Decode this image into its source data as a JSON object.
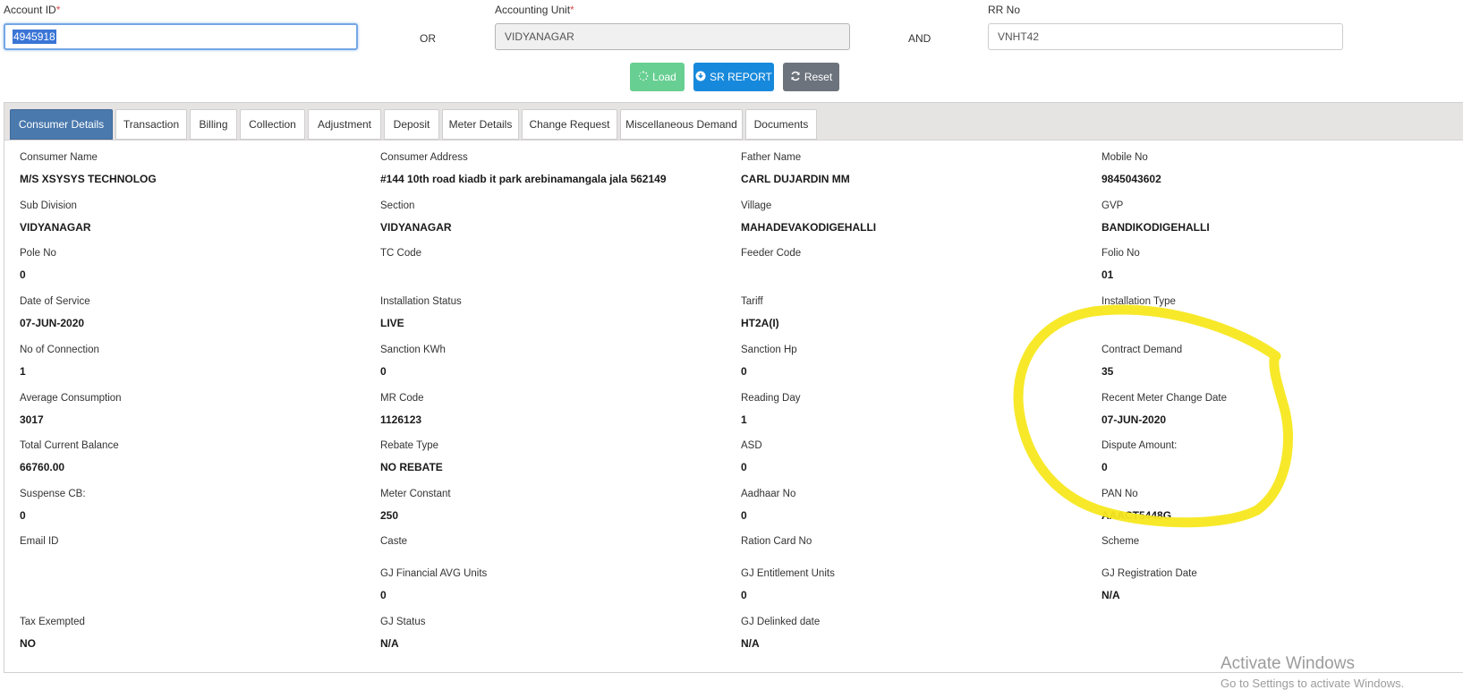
{
  "search": {
    "account_label": "Account ID",
    "account_value": "4945918",
    "or_text": "OR",
    "unit_label": "Accounting Unit",
    "unit_value": "VIDYANAGAR",
    "and_text": "AND",
    "rr_label": "RR No",
    "rr_value": "VNHT42",
    "required_mark": "*"
  },
  "buttons": {
    "load": "Load",
    "sr_report": "SR REPORT",
    "reset": "Reset"
  },
  "tabs": [
    {
      "label": "Consumer Details",
      "active": true
    },
    {
      "label": "Transaction"
    },
    {
      "label": "Billing"
    },
    {
      "label": "Collection"
    },
    {
      "label": "Adjustment"
    },
    {
      "label": "Deposit"
    },
    {
      "label": "Meter Details"
    },
    {
      "label": "Change Request"
    },
    {
      "label": "Miscellaneous Demand"
    },
    {
      "label": "Documents"
    }
  ],
  "details": [
    {
      "label": "Consumer Name",
      "value": "M/S XSYSYS TECHNOLOG"
    },
    {
      "label": "Consumer Address",
      "value": "#144 10th road kiadb it park arebinamangala jala 562149"
    },
    {
      "label": "Father Name",
      "value": "CARL DUJARDIN MM"
    },
    {
      "label": "Mobile No",
      "value": "9845043602"
    },
    {
      "label": "Sub Division",
      "value": "VIDYANAGAR"
    },
    {
      "label": "Section",
      "value": "VIDYANAGAR"
    },
    {
      "label": "Village",
      "value": "MAHADEVAKODIGEHALLI"
    },
    {
      "label": "GVP",
      "value": "BANDIKODIGEHALLI"
    },
    {
      "label": "Pole No",
      "value": "0"
    },
    {
      "label": "TC Code",
      "value": ""
    },
    {
      "label": "Feeder Code",
      "value": ""
    },
    {
      "label": "Folio No",
      "value": "01"
    },
    {
      "label": "Date of Service",
      "value": "07-JUN-2020"
    },
    {
      "label": "Installation Status",
      "value": "LIVE"
    },
    {
      "label": "Tariff",
      "value": "HT2A(I)"
    },
    {
      "label": "Installation Type",
      "value": ""
    },
    {
      "label": "No of Connection",
      "value": "1"
    },
    {
      "label": "Sanction KWh",
      "value": "0"
    },
    {
      "label": "Sanction Hp",
      "value": "0"
    },
    {
      "label": "Contract Demand",
      "value": "35"
    },
    {
      "label": "Average Consumption",
      "value": "3017"
    },
    {
      "label": "MR Code",
      "value": "1126123"
    },
    {
      "label": "Reading Day",
      "value": "1"
    },
    {
      "label": "Recent Meter Change Date",
      "value": "07-JUN-2020"
    },
    {
      "label": "Total Current Balance",
      "value": "66760.00"
    },
    {
      "label": "Rebate Type",
      "value": "NO REBATE"
    },
    {
      "label": "ASD",
      "value": "0"
    },
    {
      "label": "Dispute Amount:",
      "value": "0"
    },
    {
      "label": "Suspense CB:",
      "value": "0"
    },
    {
      "label": "Meter Constant",
      "value": "250"
    },
    {
      "label": "Aadhaar No",
      "value": "0"
    },
    {
      "label": "PAN No",
      "value": "AAACT5448G"
    },
    {
      "label": "Email ID",
      "value": ""
    },
    {
      "label": "Caste",
      "value": ""
    },
    {
      "label": "Ration Card No",
      "value": ""
    },
    {
      "label": "Scheme",
      "value": ""
    },
    {
      "label": "GJ Financial AVG Units",
      "value": "0"
    },
    {
      "label": "GJ Entitlement Units",
      "value": "0"
    },
    {
      "label": "GJ Registration Date",
      "value": "N/A"
    },
    {
      "label": "Tax Exempted",
      "value": "NO"
    },
    {
      "label": "GJ Status",
      "value": "N/A"
    },
    {
      "label": "GJ Delinked date",
      "value": "N/A"
    }
  ],
  "watermark": {
    "line1": "Activate Windows",
    "line2": "Go to Settings to activate Windows."
  },
  "colors": {
    "highlight": "#f7e81e",
    "load": "#67cf91",
    "sr_report": "#1789dc",
    "reset": "#6c737d",
    "active_tab": "#4a79ad"
  }
}
